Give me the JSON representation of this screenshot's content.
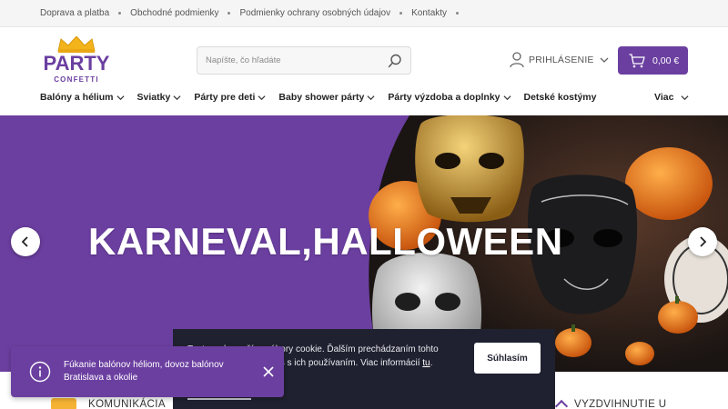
{
  "topbar": {
    "links": [
      "Doprava a platba",
      "Obchodné podmienky",
      "Podmienky ochrany osobných údajov",
      "Kontakty"
    ]
  },
  "logo": {
    "line1": "PARTY",
    "line2": "CONFETTI"
  },
  "search": {
    "placeholder": "Napíšte, čo hľadáte",
    "icon": "search-icon"
  },
  "account": {
    "label": "PRIHLÁSENIE",
    "icon": "user-icon"
  },
  "cart": {
    "label": "0,00 €",
    "icon": "cart-icon"
  },
  "nav": {
    "items": [
      {
        "label": "Balóny a hélium",
        "dropdown": true
      },
      {
        "label": "Sviatky",
        "dropdown": true
      },
      {
        "label": "Párty pre deti",
        "dropdown": true
      },
      {
        "label": "Baby shower párty",
        "dropdown": true
      },
      {
        "label": "Párty výzdoba a doplnky",
        "dropdown": true
      },
      {
        "label": "Detské kostýmy",
        "dropdown": false
      }
    ],
    "more": "Viac"
  },
  "hero": {
    "title": "KARNEVAL,HALLOWEEN"
  },
  "features": {
    "left": "KOMUNIKÁCIA",
    "right": "VYZDVIHNUTIE U"
  },
  "cookie": {
    "text_part1": "Tento web používa súbory cookie. Ďalším prechádzaním tohto webu vyjadrujete súhlas s ich používaním. Viac informácií",
    "link": "tu",
    "text_part2": ".",
    "accept": "Súhlasím"
  },
  "toast": {
    "message": "Fúkanie balónov héliom, dovoz balónov Bratislava a okolie"
  },
  "colors": {
    "brand": "#6b3fa0",
    "logo_gold": "#f3b31b",
    "cookie_bg": "#1f2130"
  }
}
